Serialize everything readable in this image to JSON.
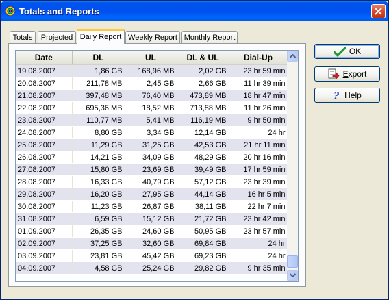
{
  "window": {
    "title": "Totals and Reports"
  },
  "tabs": [
    {
      "label": "Totals"
    },
    {
      "label": "Projected"
    },
    {
      "label": "Daily Report",
      "active": true
    },
    {
      "label": "Weekly Report"
    },
    {
      "label": "Monthly Report"
    }
  ],
  "table": {
    "columns": [
      "Date",
      "DL",
      "UL",
      "DL & UL",
      "Dial-Up"
    ],
    "rows": [
      [
        "19.08.2007",
        "1,86 GB",
        "168,96 MB",
        "2,02 GB",
        "23 hr 59 min"
      ],
      [
        "20.08.2007",
        "211,78 MB",
        "2,45 GB",
        "2,66 GB",
        "11 hr 39 min"
      ],
      [
        "21.08.2007",
        "397,48 MB",
        "76,40 MB",
        "473,89 MB",
        "18 hr 47 min"
      ],
      [
        "22.08.2007",
        "695,36 MB",
        "18,52 MB",
        "713,88 MB",
        "11 hr 26 min"
      ],
      [
        "23.08.2007",
        "110,77 MB",
        "5,41 MB",
        "116,19 MB",
        "9 hr 50 min"
      ],
      [
        "24.08.2007",
        "8,80 GB",
        "3,34 GB",
        "12,14 GB",
        "24 hr"
      ],
      [
        "25.08.2007",
        "11,29 GB",
        "31,25 GB",
        "42,53 GB",
        "21 hr 11 min"
      ],
      [
        "26.08.2007",
        "14,21 GB",
        "34,09 GB",
        "48,29 GB",
        "20 hr 16 min"
      ],
      [
        "27.08.2007",
        "15,80 GB",
        "23,69 GB",
        "39,49 GB",
        "17 hr 59 min"
      ],
      [
        "28.08.2007",
        "16,33 GB",
        "40,79 GB",
        "57,12 GB",
        "23 hr 39 min"
      ],
      [
        "29.08.2007",
        "16,20 GB",
        "27,95 GB",
        "44,14 GB",
        "16 hr 5 min"
      ],
      [
        "30.08.2007",
        "11,23 GB",
        "26,87 GB",
        "38,11 GB",
        "22 hr 7 min"
      ],
      [
        "31.08.2007",
        "6,59 GB",
        "15,12 GB",
        "21,72 GB",
        "23 hr 42 min"
      ],
      [
        "01.09.2007",
        "26,35 GB",
        "24,60 GB",
        "50,95 GB",
        "23 hr 57 min"
      ],
      [
        "02.09.2007",
        "37,25 GB",
        "32,60 GB",
        "69,84 GB",
        "24 hr"
      ],
      [
        "03.09.2007",
        "23,81 GB",
        "45,42 GB",
        "69,23 GB",
        "24 hr"
      ],
      [
        "04.09.2007",
        "4,58 GB",
        "25,24 GB",
        "29,82 GB",
        "9 hr 35 min"
      ]
    ]
  },
  "buttons": {
    "ok": {
      "prefix": "",
      "accel": "",
      "rest": "OK",
      "icon": "checkmark-icon"
    },
    "export": {
      "prefix": "",
      "accel": "E",
      "rest": "xport",
      "icon": "export-icon"
    },
    "help": {
      "prefix": "",
      "accel": "H",
      "rest": "elp",
      "icon": "help-icon"
    }
  },
  "colors": {
    "titlebar": "#0054E3",
    "row_alt": "#E3E3EF",
    "active_tab_accent": "#FFC83C",
    "close_button": "#D8492A"
  }
}
